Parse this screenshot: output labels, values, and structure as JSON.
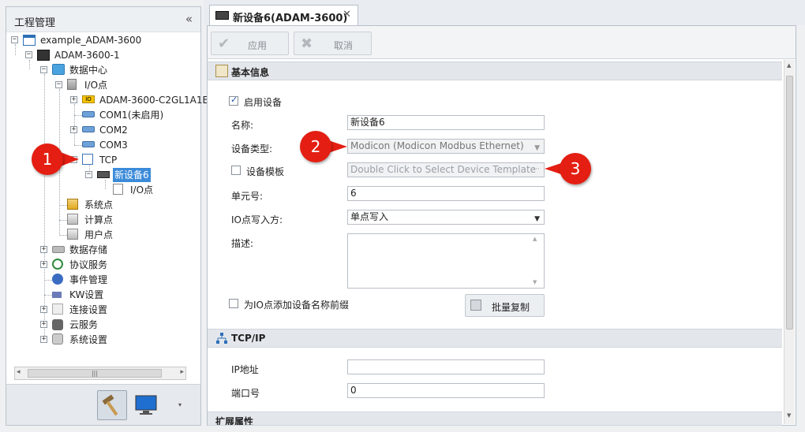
{
  "left_panel": {
    "title": "工程管理",
    "collapse_icon": "double-chevron-left-icon",
    "tree": {
      "project": "example_ADAM-3600",
      "device": "ADAM-3600-1",
      "data_center": "数据中心",
      "io_point": "I/O点",
      "io_module": "ADAM-3600-C2GL1A1E",
      "com1": "COM1(未启用)",
      "com2": "COM2",
      "com3": "COM3",
      "tcp": "TCP",
      "new_device": "新设备6",
      "new_device_io": "I/O点",
      "system_point": "系统点",
      "calc_point": "计算点",
      "user_point": "用户点",
      "data_storage": "数据存储",
      "protocol_service": "协议服务",
      "event_mgmt": "事件管理",
      "kw_settings": "KW设置",
      "connection_settings": "连接设置",
      "cloud_service": "云服务",
      "system_settings": "系统设置"
    },
    "scrollbar_grip": "|||",
    "bottom_icons": [
      "hammer-icon",
      "monitor-icon",
      "dropdown-arrow-icon"
    ]
  },
  "tab": {
    "title": "新设备6(ADAM-3600)",
    "close": "✕"
  },
  "toolbar": {
    "apply": "应用",
    "cancel": "取消"
  },
  "basic": {
    "title": "基本信息",
    "enable_label": "启用设备",
    "enable_checked": true,
    "name_label": "名称:",
    "name_value": "新设备6",
    "type_label": "设备类型:",
    "type_value": "Modicon (Modicon Modbus Ethernet)",
    "template_label": "设备模板",
    "template_checked": false,
    "template_placeholder": "Double Click to Select Device Template",
    "template_ellipsis": "···",
    "unit_label": "单元号:",
    "unit_value": "6",
    "io_write_label": "IO点写入方:",
    "io_write_value": "单点写入",
    "desc_label": "描述:",
    "desc_value": "",
    "prefix_label": "为IO点添加设备名称前缀",
    "prefix_checked": false,
    "batch_copy": "批量复制"
  },
  "tcpip": {
    "title": "TCP/IP",
    "ip_label": "IP地址",
    "ip_value": "",
    "port_label": "端口号",
    "port_value": "0"
  },
  "extended": {
    "title": "扩展属性"
  },
  "callouts": [
    "1",
    "2",
    "3"
  ],
  "colors": {
    "callout": "#e41e12",
    "selection": "#3c8bd9",
    "section_bg": "#e3e7ec"
  }
}
